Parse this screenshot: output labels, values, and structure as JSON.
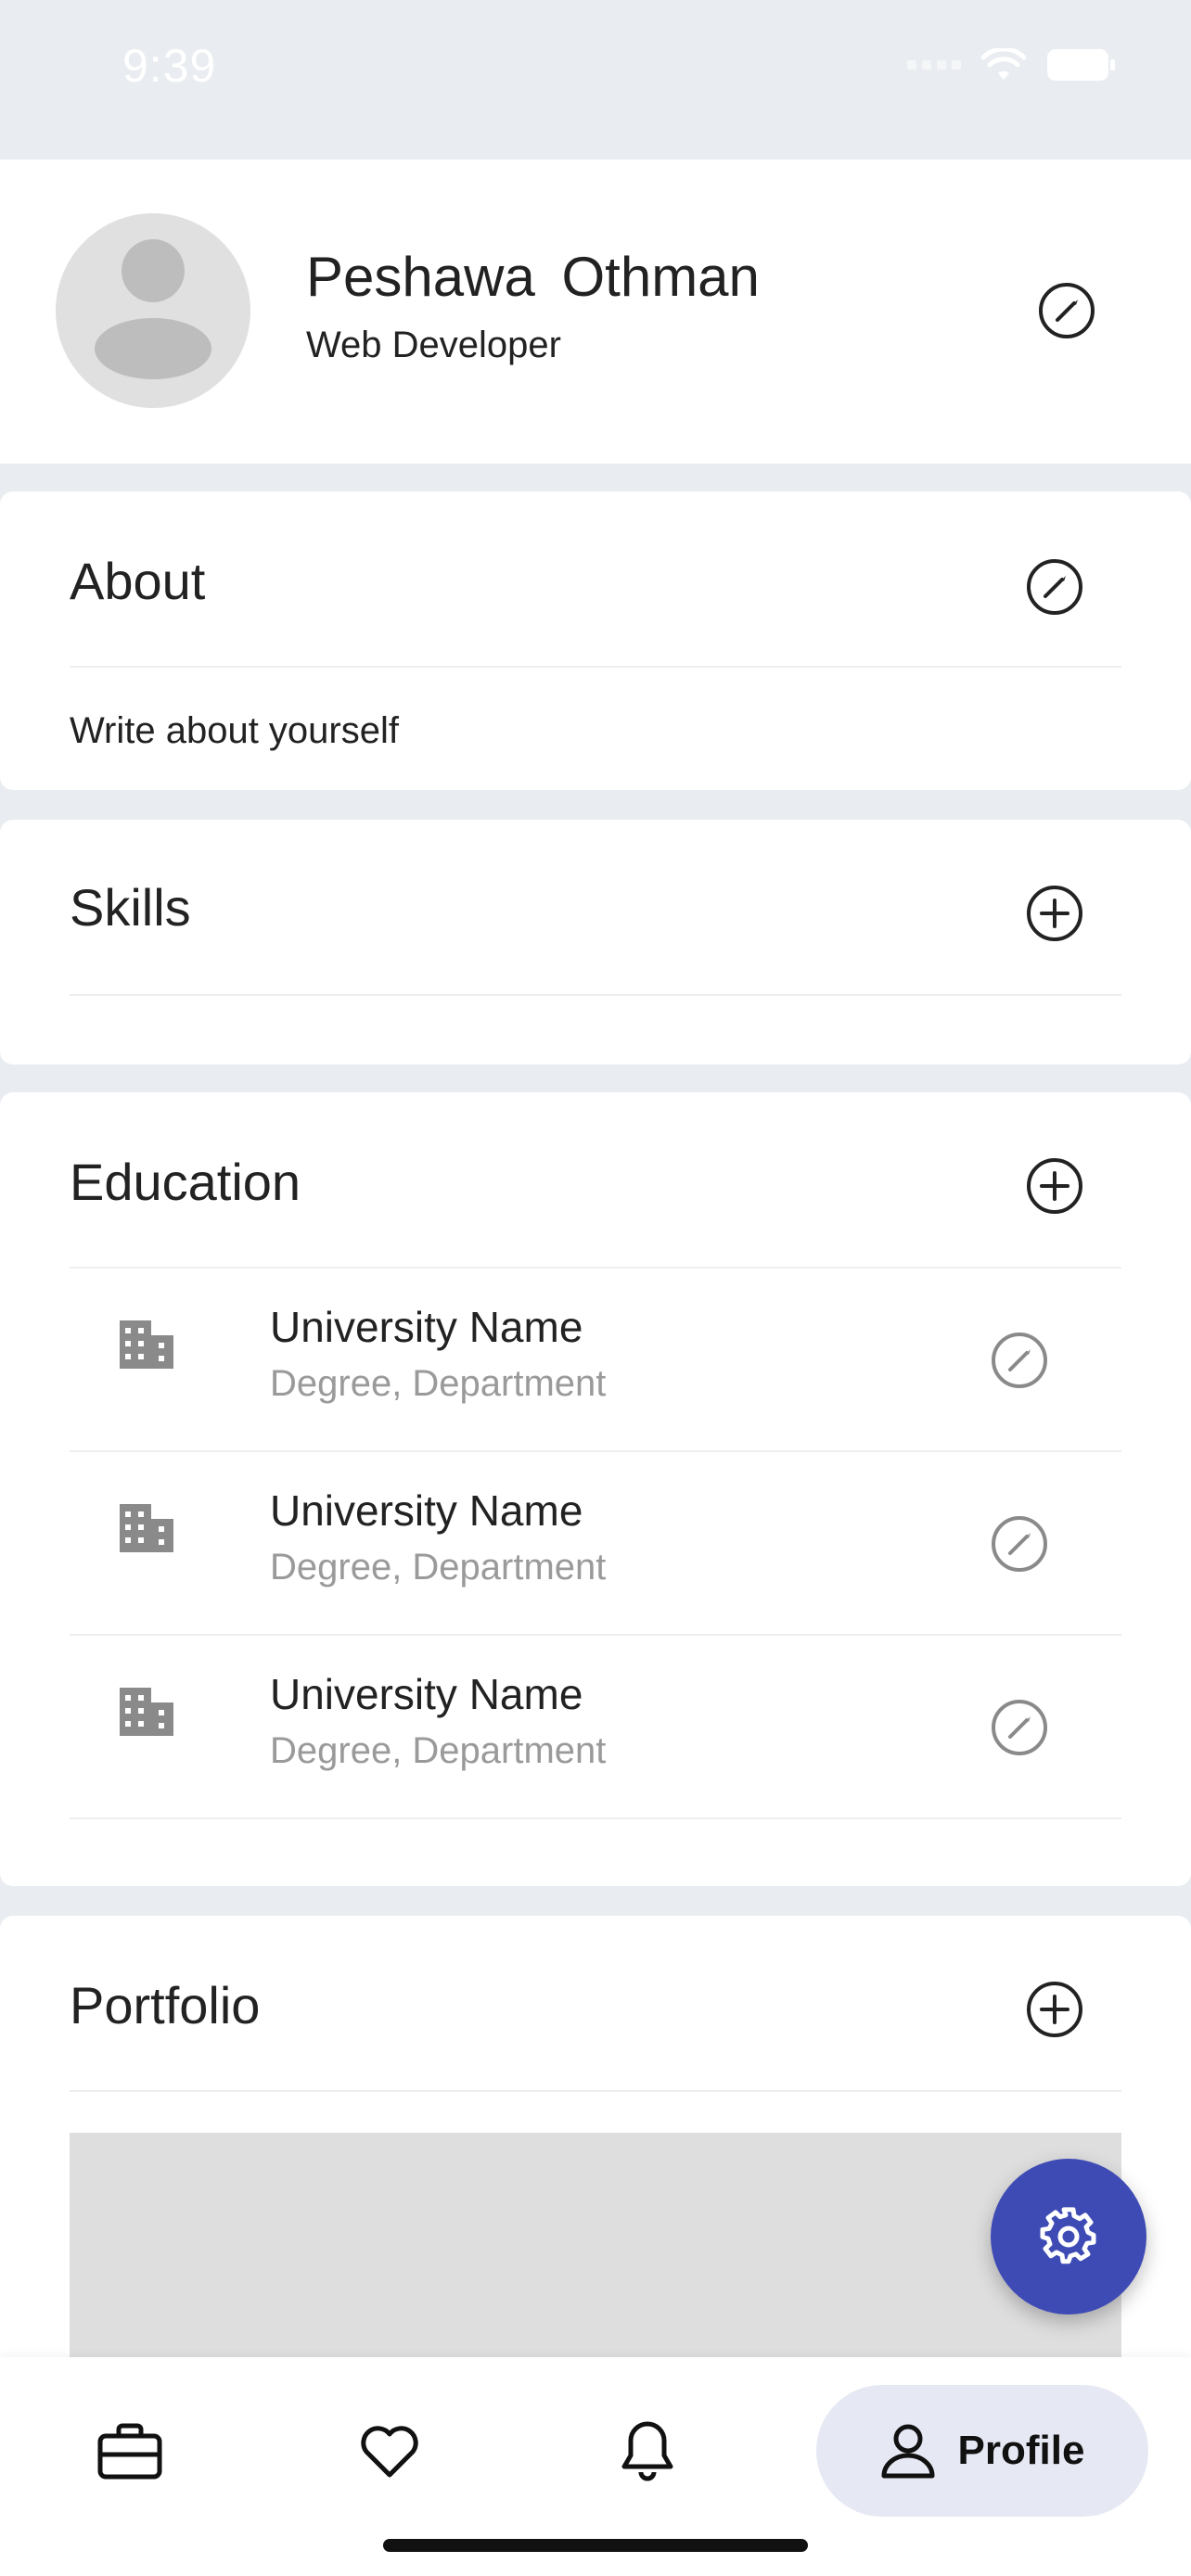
{
  "status_bar": {
    "time": "9:39"
  },
  "profile": {
    "name": "Peshawa  Othman",
    "role": "Web Developer"
  },
  "about": {
    "title": "About",
    "placeholder_text": "Write about yourself"
  },
  "skills": {
    "title": "Skills"
  },
  "education": {
    "title": "Education",
    "items": [
      {
        "name": "University Name",
        "details": "Degree,  Department"
      },
      {
        "name": "University Name",
        "details": "Degree,  Department"
      },
      {
        "name": "University Name",
        "details": "Degree,  Department"
      }
    ]
  },
  "portfolio": {
    "title": "Portfolio"
  },
  "bottom_nav": {
    "items": [
      {
        "icon": "briefcase-icon"
      },
      {
        "icon": "heart-icon"
      },
      {
        "icon": "bell-icon"
      },
      {
        "icon": "person-icon",
        "label": "Profile",
        "active": true
      }
    ]
  },
  "colors": {
    "accent": "#3e4bb5",
    "active_nav_bg": "#e6e8f4",
    "background": "#e9ecf0",
    "muted_text": "#9a9a9a"
  }
}
